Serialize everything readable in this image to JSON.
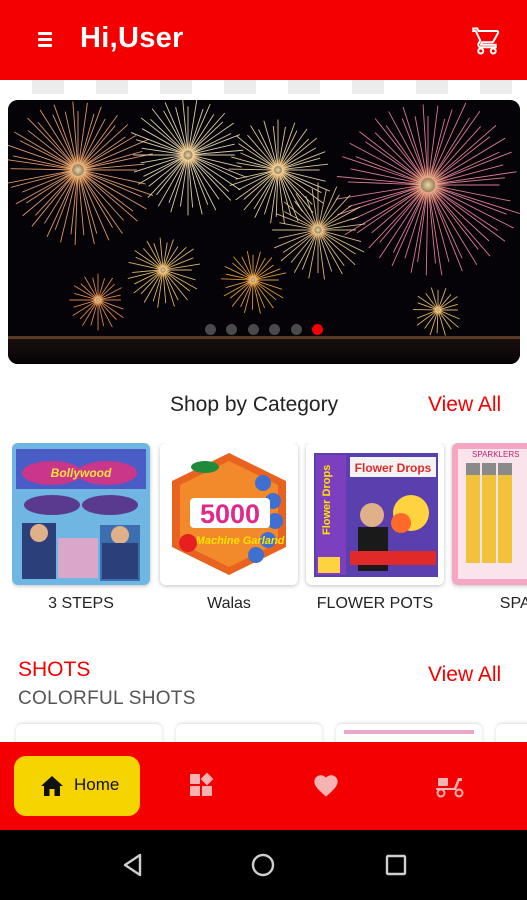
{
  "header": {
    "title": "Hi,User",
    "menu_icon": "hamburger-menu-icon",
    "cart_icon": "shopping-cart-icon",
    "background_color": "#f50000"
  },
  "banner": {
    "dots_total": 6,
    "active_dot": 6,
    "active_color": "#f50000"
  },
  "categories": {
    "title": "Shop by Category",
    "view_all": "View All",
    "items": [
      {
        "label": "3 STEPS",
        "image_text": "Bollywood"
      },
      {
        "label": "Walas",
        "image_text": "5000",
        "image_subtext": "Machine Garland"
      },
      {
        "label": "FLOWER POTS",
        "image_text": "Flower Drops"
      },
      {
        "label": "SPAR",
        "image_text": "SPARKLERS"
      }
    ]
  },
  "shots": {
    "title": "SHOTS",
    "subtitle": "COLORFUL SHOTS",
    "view_all": "View All"
  },
  "bottom_nav": {
    "background_color": "#f50000",
    "active_color": "#f5d400",
    "items": [
      {
        "label": "Home",
        "icon": "home-icon",
        "active": true
      },
      {
        "label": "",
        "icon": "categories-icon",
        "active": false
      },
      {
        "label": "",
        "icon": "heart-icon",
        "active": false
      },
      {
        "label": "",
        "icon": "delivery-scooter-icon",
        "active": false
      }
    ]
  },
  "system_nav": {
    "buttons": [
      "back-icon",
      "home-circle-icon",
      "recents-icon"
    ]
  }
}
